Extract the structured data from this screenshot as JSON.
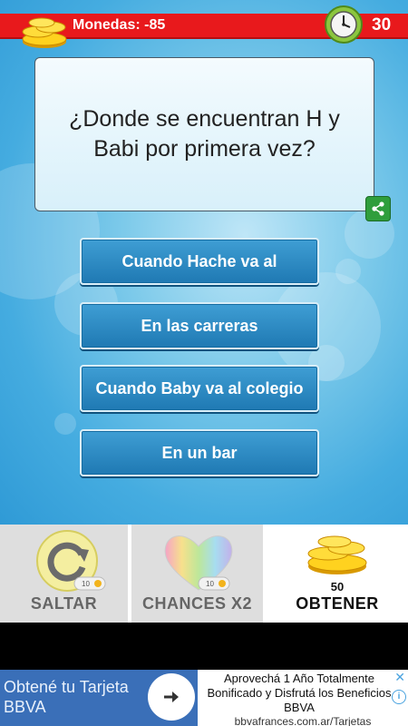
{
  "header": {
    "coins_label": "Monedas: -85",
    "timer": "30",
    "bar_color": "#e8191c"
  },
  "question": {
    "text": "¿Donde se encuentran H y Babi por primera vez?"
  },
  "answers": [
    {
      "label": "Cuando Hache va al"
    },
    {
      "label": "En las carreras"
    },
    {
      "label": "Cuando Baby va al colegio"
    },
    {
      "label": "En un bar"
    }
  ],
  "powerups": {
    "skip": {
      "label": "SALTAR",
      "cost": "10"
    },
    "double": {
      "label": "CHANCES X2",
      "cost": "10"
    },
    "obtain": {
      "label": "OBTENER",
      "amount": "50"
    }
  },
  "ad": {
    "left_text": "Obtené tu Tarjeta BBVA",
    "right_text": "Aprovechá 1 Año Totalmente Bonificado y Disfrutá los Beneficios BBVA",
    "url": "bbvafrances.com.ar/Tarjetas",
    "close_glyph": "✕",
    "info_glyph": "i",
    "color": "#3a6fb8"
  }
}
